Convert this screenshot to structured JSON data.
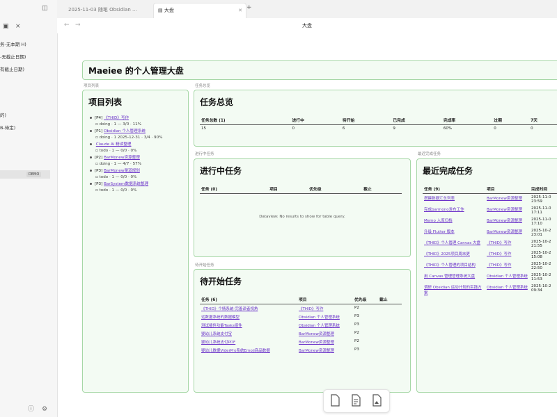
{
  "sidebar": {
    "items": [
      "务-无本期 H)",
      "-无截止日期)",
      "有截止日期)",
      "",
      "",
      "",
      "",
      "的)",
      "B-待定)",
      ""
    ],
    "badge": "DEMO"
  },
  "tabs": [
    {
      "label": "2025-11-03 随笔 Obsidian ..."
    },
    {
      "label": "大盘"
    }
  ],
  "doc_title": "大盘",
  "dashboard": {
    "title": "Maeiee 的个人管理大盘",
    "section_labels": {
      "projects": "项目列表",
      "overview": "任务总览",
      "in_progress": "进行中任务",
      "recent_done": "最近完成任务",
      "todo": "待开始任务"
    },
    "projects": {
      "heading": "项目列表",
      "items": [
        {
          "prefix": "[P4]",
          "name": "《THID》写作",
          "status": "doing · 1 — 3/0 · 11%"
        },
        {
          "prefix": "[P1]",
          "name": "Obsidian 个人管理系统",
          "status": "doing · 1 2025-12-31 · 3/4 · 90%"
        },
        {
          "prefix": "",
          "name": "Claude Ai 精读整理",
          "status": "todo · 1 — 0/0 · 0%"
        },
        {
          "prefix": "[P2]",
          "name": "BarMonew资源整理",
          "status": "doing · 1 — 4/7 · 57%"
        },
        {
          "prefix": "[P3]",
          "name": "BarMonew渠道规划",
          "status": "todo · 1 — 0/0 · 0%"
        },
        {
          "prefix": "[P3]",
          "name": "BarSystem数据系统整理",
          "status": "todo · 1 — 0/0 · 0%"
        }
      ]
    },
    "overview": {
      "heading": "任务总览",
      "headers": [
        "任务总数 (1)",
        "进行中",
        "待开始",
        "已完成",
        "完成率",
        "过期",
        "7天"
      ],
      "row": [
        "15",
        "0",
        "6",
        "9",
        "60%",
        "0",
        "0"
      ]
    },
    "in_progress": {
      "heading": "进行中任务",
      "headers": [
        "任务 (0)",
        "项目",
        "优先级",
        "截止"
      ],
      "empty": "Dataview: No results to show for table query."
    },
    "recent_done": {
      "heading": "最近完成任务",
      "headers": [
        "任务 (9)",
        "项目",
        "完成时间"
      ],
      "rows": [
        {
          "task": "搭建数据汇总列表",
          "project": "BarMonew资源整理",
          "time": "2025-11-0 23:59"
        },
        {
          "task": "完成barmono发布工作",
          "project": "BarMonew资源整理",
          "time": "2025-11-0 17:11"
        },
        {
          "task": "Memo 入库归档",
          "project": "BarMonew资源整理",
          "time": "2025-11-0 17:10"
        },
        {
          "task": "升级 Flutter 版本",
          "project": "BarMonew资源整理",
          "time": "2025-10-2 23:01"
        },
        {
          "task": "《THID》个人管理 Canvas 大盘",
          "project": "《THID》写作",
          "time": "2025-10-2 21:55"
        },
        {
          "task": "《THID》2025项目周末更",
          "project": "《THID》写作",
          "time": "2025-10-2 15:08"
        },
        {
          "task": "《THID》个人管理的项目结构",
          "project": "《THID》写作",
          "time": "2025-10-2 22:50"
        },
        {
          "task": "用 Canvas 管理管理系统大盘",
          "project": "Obsidian 个人管理系统",
          "time": "2025-10-2 11:53"
        },
        {
          "task": "调研 Obsidian 运动计划的实践方案",
          "project": "Obsidian 个人管理系统",
          "time": "2025-10-2 09:34"
        }
      ]
    },
    "todo": {
      "heading": "待开始任务",
      "headers": [
        "任务 (6)",
        "项目",
        "优先级",
        "截止"
      ],
      "rows": [
        {
          "task": "《THID》个情系统-完善读者视角",
          "project": "《THID》写作",
          "priority": "P2",
          "due": ""
        },
        {
          "task": "远数据系统的数据模型",
          "project": "Obsidian 个人管理系统",
          "priority": "P3",
          "due": ""
        },
        {
          "task": "测试插件功能Tasks组件",
          "project": "Obsidian 个人管理系统",
          "priority": "P3",
          "due": ""
        },
        {
          "task": "婴幼儿系统支付宝",
          "project": "BarMonew资源整理",
          "priority": "P2",
          "due": ""
        },
        {
          "task": "婴幼儿系统支付PDF",
          "project": "BarMonew资源整理",
          "priority": "P2",
          "due": ""
        },
        {
          "task": "婴幼儿数据ViderPro系统Emoji商品数据",
          "project": "BarMonew资源整理",
          "priority": "P3",
          "due": ""
        }
      ]
    }
  },
  "colors": {
    "panel_bg": "#f3fbf3",
    "panel_border": "#a6d7a6",
    "link": "#6a32c9"
  }
}
